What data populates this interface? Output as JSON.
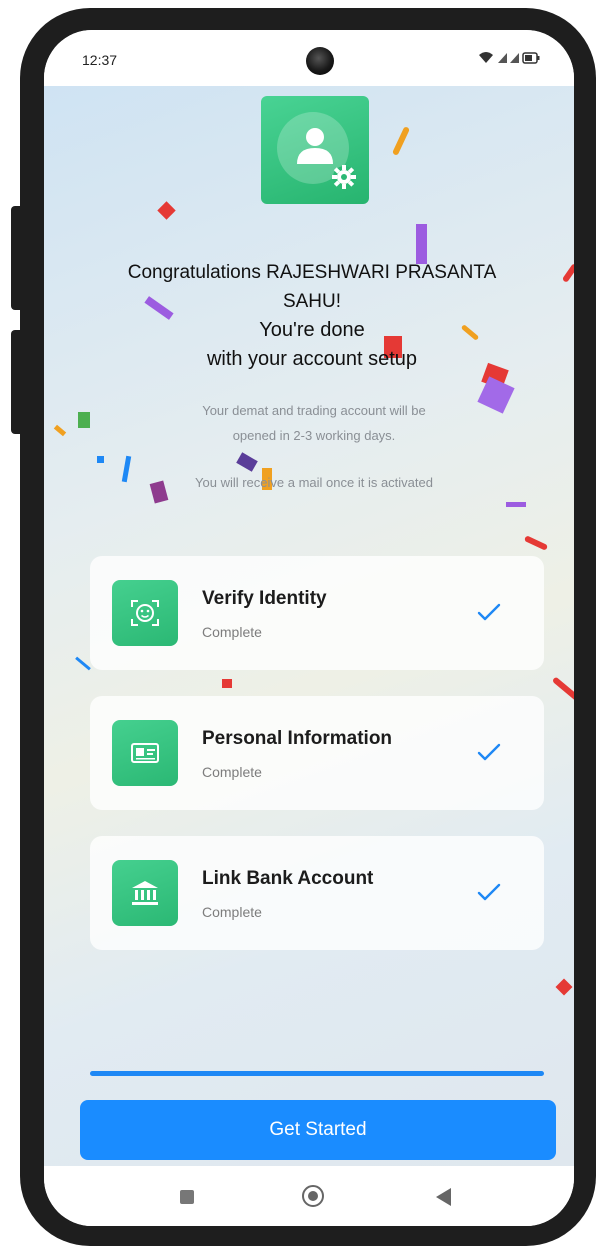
{
  "status_bar": {
    "time": "12:37",
    "icons": "wifi-icon signal-icon battery-icon"
  },
  "header": {
    "icon": "user-settings-icon"
  },
  "congrats": {
    "line1": "Congratulations RAJESHWARI PRASANTA",
    "line2": "SAHU!",
    "line3": "You're done",
    "line4": "with your account setup"
  },
  "note": {
    "line1": "Your demat and trading account will be",
    "line2": "opened in 2-3 working days.",
    "line3": "You will receive a mail once it is activated"
  },
  "steps": [
    {
      "title": "Verify Identity",
      "status": "Complete",
      "icon": "face-scan-icon"
    },
    {
      "title": "Personal Information",
      "status": "Complete",
      "icon": "id-card-icon"
    },
    {
      "title": "Link Bank Account",
      "status": "Complete",
      "icon": "bank-icon"
    }
  ],
  "progress": {
    "value": 1.0
  },
  "cta": {
    "label": "Get Started"
  },
  "colors": {
    "accent": "#1a8cff",
    "success": "#2bb874",
    "check": "#1e88f5"
  }
}
